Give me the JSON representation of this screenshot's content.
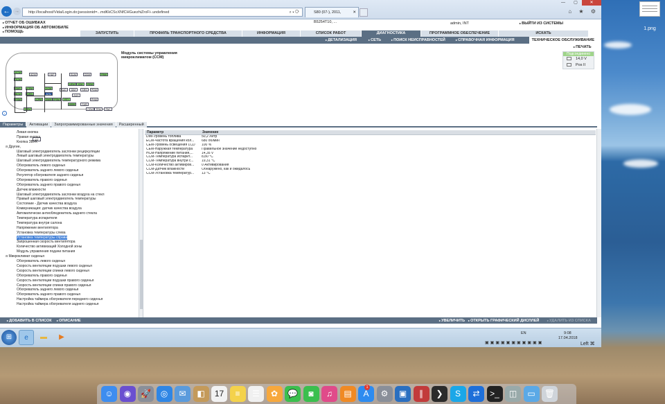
{
  "desktop": {
    "file_label": "1.png"
  },
  "browser": {
    "back_icon": "back-arrow-icon",
    "address": "http://localhost/Vida/Login.do;jsessionid=...mdKkCScXNfCHGuezhiZroFi-.undefined",
    "address_controls": "⌕ ▾ ⟳",
    "tab_title": "S80 (07-), 2011, B5254T10, ...",
    "toolbar_icons": "⌂ ★ ⚙"
  },
  "app": {
    "top_menu": [
      "ОТЧЕТ ОБ ОШИБКАХ",
      "ИНФОРМАЦИЯ ОБ АВТОМОБИЛЕ",
      "ПОМОЩЬ"
    ],
    "user": "admin, INT",
    "logout": "ВЫЙТИ ИЗ СИСТЕМЫ",
    "main_nav": [
      {
        "label": "ЗАПУСТИТЬ",
        "active": false
      },
      {
        "label": "ПРОФИЛЬ ТРАНСПОРТНОГО СРЕДСТВА",
        "active": false
      },
      {
        "label": "ИНФОРМАЦИЯ",
        "active": false
      },
      {
        "label": "СПИСОК РАБОТ",
        "active": false
      },
      {
        "label": "ДИАГНОСТИКА",
        "active": true
      },
      {
        "label": "ПРОГРАММНОЕ ОБЕСПЕЧЕНИЕ",
        "active": false
      },
      {
        "label": "ИСКАТЬ",
        "active": false
      }
    ],
    "sub_nav": [
      "ДЕТАЛИЗАЦИЯ",
      "СЕТЬ",
      "ПОИСК НЕИСПРАВНОСТЕЙ",
      "СПРАВОЧНАЯ ИНФОРМАЦИЯ"
    ],
    "sub_nav_tail": "ТЕХНИЧЕСКОЕ ОБСЛУЖИВАНИЕ",
    "print": "ПЕЧАТЬ",
    "status": {
      "header": "Подсоединено",
      "voltage": "14,0 V",
      "pos": "Pos II"
    },
    "module_title": [
      "Модуль системы управления",
      "микроклиматом (CCM)"
    ],
    "diagram": {
      "nodes": [
        "ECM",
        "TCM",
        "ADM",
        "HUP",
        "SUM",
        "DDM",
        "PAM",
        "SAS",
        "BCM",
        "PSM",
        "CEM",
        "SRS",
        "CCM",
        "AEM",
        "CPM",
        "SWM",
        "UEM",
        "ICM",
        "REM",
        "AUD",
        "DIM",
        "SRS",
        "PDM",
        "RTI",
        "AUX",
        "PHM",
        "MMM",
        "SUB",
        "PSM",
        "DEM",
        "CEM",
        "TRM",
        "PAC"
      ],
      "dtc_label": "DT"
    },
    "tabs": [
      {
        "label": "Параметры",
        "active": true
      },
      {
        "label": "Активации",
        "active": false
      },
      {
        "label": "Запрограммированные значения",
        "active": false
      },
      {
        "label": "Расширенный",
        "active": false
      }
    ],
    "tree": [
      {
        "level": 1,
        "label": "Левая кнопка"
      },
      {
        "level": 1,
        "label": "Правая кнопка"
      },
      {
        "level": 1,
        "label": "Кнопка ЗВУК"
      },
      {
        "level": 0,
        "label": "Другие,"
      },
      {
        "level": 1,
        "label": "Шаговый электродвигатель заслонки рециркуляции"
      },
      {
        "level": 1,
        "label": "Левый шаговый электродвигатель температуры"
      },
      {
        "level": 1,
        "label": "Шаговый электродвигатель температурного режима"
      },
      {
        "level": 1,
        "label": "Обогреватель левого сиденья"
      },
      {
        "level": 1,
        "label": "Обогреватель заднего левого сиденья"
      },
      {
        "level": 1,
        "label": "Регулятор обогревателя заднего сиденья"
      },
      {
        "level": 1,
        "label": "Обогреватель правого сиденья"
      },
      {
        "level": 1,
        "label": "Обогреватель заднего правого сиденья"
      },
      {
        "level": 1,
        "label": "Датчик влажности"
      },
      {
        "level": 1,
        "label": "Шаговый электродвигатель заслонки воздуха на стекл"
      },
      {
        "level": 1,
        "label": "Правый шаговый электродвигатель температуры"
      },
      {
        "level": 1,
        "label": "Состояние - Датчик качества воздуха"
      },
      {
        "level": 1,
        "label": "Коммуникация: датчик качества воздуха"
      },
      {
        "level": 1,
        "label": "Автоматически антиобледенитель заднего стекла"
      },
      {
        "level": 1,
        "label": "Температура испарителя"
      },
      {
        "level": 1,
        "label": "Температура внутри салона"
      },
      {
        "level": 1,
        "label": "Напряжение вентилятора"
      },
      {
        "level": 1,
        "label": "Установка температуры слева"
      },
      {
        "level": 1,
        "label": "Установка температуры справа",
        "selected": true
      },
      {
        "level": 1,
        "label": "Запрошенная скорость вентилятора"
      },
      {
        "level": 1,
        "label": "Количество активизаций Холодной зоны"
      },
      {
        "level": 1,
        "label": "Модуль управления подачи питания"
      },
      {
        "level": 0,
        "label": "Микроклимат сиденья"
      },
      {
        "level": 1,
        "label": "Обогреватель левого сиденья"
      },
      {
        "level": 1,
        "label": "Скорость вентиляции подушки левого сиденья"
      },
      {
        "level": 1,
        "label": "Скорость вентиляции спинки левого сиденья"
      },
      {
        "level": 1,
        "label": "Обогреватель правого сиденья"
      },
      {
        "level": 1,
        "label": "Скорость вентиляции подушки правого сиденья"
      },
      {
        "level": 1,
        "label": "Скорость вентиляции спинки правого сиденья"
      },
      {
        "level": 1,
        "label": "Обогреватель заднего левого сиденья"
      },
      {
        "level": 1,
        "label": "Обогреватель заднего правого сиденья"
      },
      {
        "level": 1,
        "label": "Настройка таймера обогревателя переднего сиденья"
      },
      {
        "level": 1,
        "label": "Настройка таймера обогревателя заднего сиденья"
      }
    ],
    "params": {
      "headers": [
        "Параметр",
        "Значение"
      ],
      "rows": [
        [
          "DIM-Уровень топлива",
          "50,2 Литр"
        ],
        [
          "ECM-Частота вращения кол...",
          "680 об/мин"
        ],
        [
          "CEM-Уровень освещения LCD",
          "100 %"
        ],
        [
          "CEM-Наружная температура",
          "Правильное значение недоступно"
        ],
        [
          "HCM-Напряжение питания,...",
          "14,35 V"
        ],
        [
          "CCM-Температура испарит...",
          "8,80 °C"
        ],
        [
          "CCM-Температура внутри с...",
          "19,31 °C"
        ],
        [
          "CCM-Количество активиров...",
          "0 Активирования"
        ],
        [
          "CCM-Датчик влажности",
          "Обнаружено, как и ожидалось"
        ],
        [
          "CCM-Установка температур...",
          "13 °C"
        ]
      ]
    },
    "bottom_bar": {
      "add_to_list": "ДОБАВИТЬ В СПИСОК",
      "description": "ОПИСАНИЕ",
      "zoom": "УВЕЛИЧИТЬ",
      "open_graph": "ОТКРЫТЬ ГРАФИЧЕСКИЙ ДИСПЛЕЙ",
      "remove_from_list": "УДАЛИТЬ ИЗ СПИСКА"
    }
  },
  "taskbar": {
    "lang": "EN",
    "time": "9:08",
    "date": "17.04.2018",
    "left_label": "Left ⌘"
  },
  "dock": {
    "apps": [
      "finder-icon",
      "siri-icon",
      "launchpad-icon",
      "safari-icon",
      "mail-icon",
      "contacts-icon",
      "calendar-icon",
      "notes-icon",
      "reminders-icon",
      "photos-icon",
      "messages-icon",
      "facetime-icon",
      "itunes-icon",
      "books-icon",
      "app-store-icon",
      "system-preferences-icon",
      "virtualbox-icon",
      "parallels-icon",
      "plex-icon",
      "skype-icon",
      "teamviewer-icon",
      "terminal-icon",
      "preview-icon",
      "folder-icon",
      "trash-icon"
    ],
    "calendar_day": "17",
    "app_store_badge": "1"
  }
}
